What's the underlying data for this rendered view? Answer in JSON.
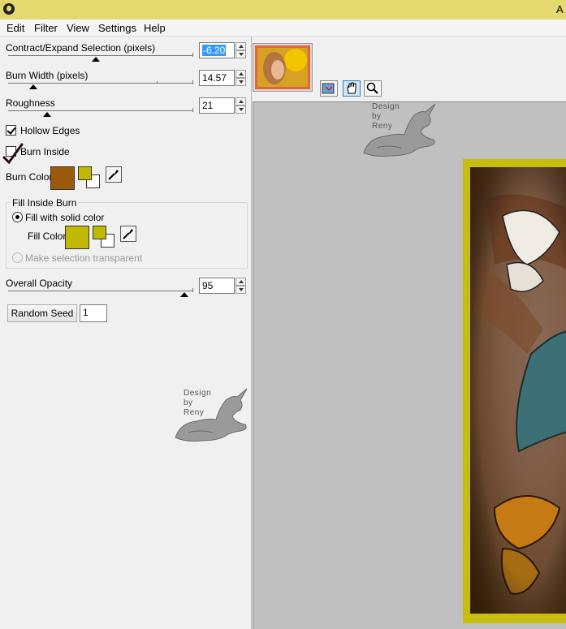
{
  "window": {
    "title": "A"
  },
  "menu": [
    "Edit",
    "Filter",
    "View",
    "Settings",
    "Help"
  ],
  "controls": {
    "contract_expand": {
      "label": "Contract/Expand Selection (pixels)",
      "value": "-6.20"
    },
    "burn_width": {
      "label": "Burn Width (pixels)",
      "value": "14.57"
    },
    "roughness": {
      "label": "Roughness",
      "value": "21"
    },
    "hollow_edges": {
      "label": "Hollow Edges",
      "checked": true
    },
    "burn_inside": {
      "label": "Burn Inside",
      "checked": false
    },
    "burn_color": {
      "label": "Burn Color",
      "color": "#9b5a0a"
    },
    "fill_group": {
      "title": "Fill Inside Burn",
      "fill_solid_label": "Fill with solid color",
      "fill_color_label": "Fill Color",
      "fill_color": "#c2b800",
      "transparent_label": "Make selection transparent"
    },
    "overall_opacity": {
      "label": "Overall Opacity",
      "value": "95"
    },
    "random_seed": {
      "label": "Random Seed",
      "value": "1"
    }
  },
  "watermark": {
    "line1": "Design",
    "line2": "by",
    "line3": "Reny"
  },
  "colors": {
    "frame": "#c6bd10",
    "canvas_bg": "#c0c0c0",
    "titlebar": "#e4d96f"
  }
}
